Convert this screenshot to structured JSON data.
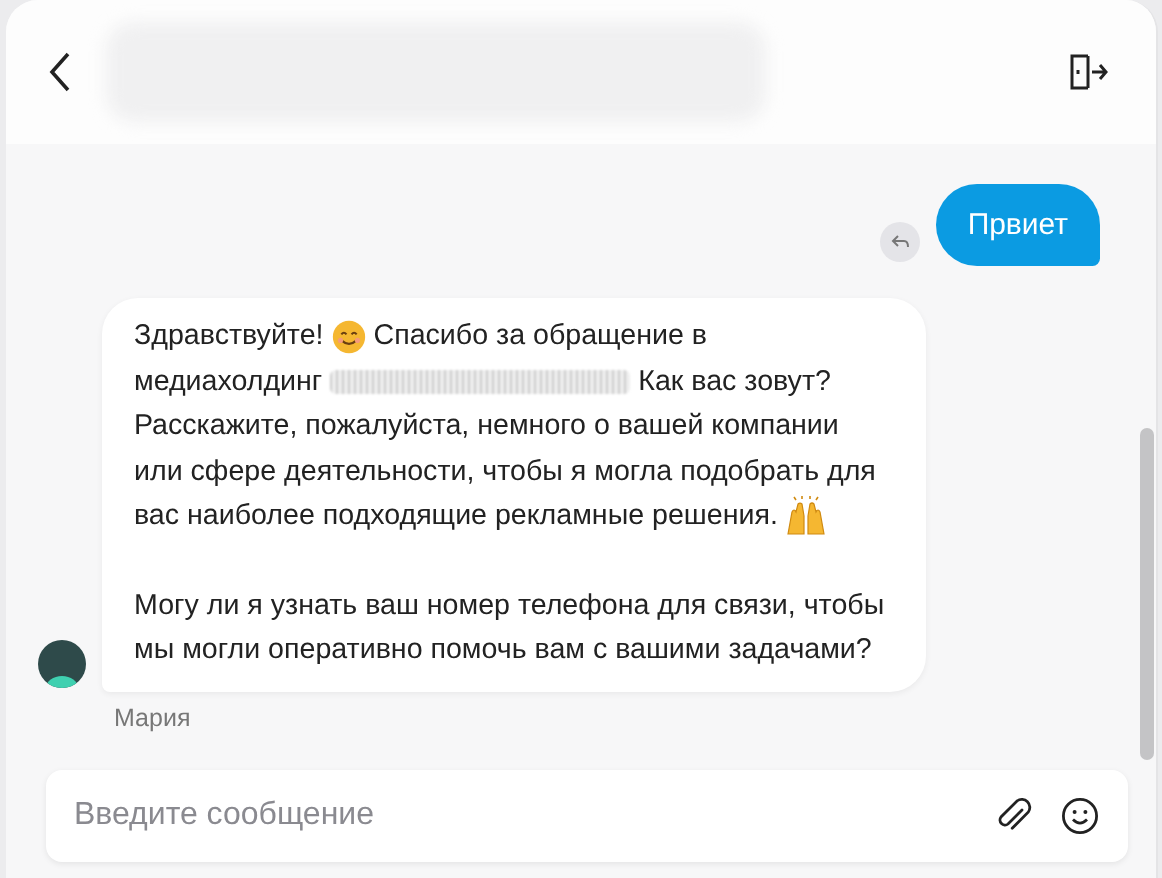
{
  "header": {
    "title_redacted": true
  },
  "messages": [
    {
      "kind": "outgoing",
      "text": "Првиет",
      "reply_icon": true
    },
    {
      "kind": "incoming",
      "author": "Мария",
      "paragraphs": [
        [
          [
            {
              "kind": "text",
              "text": "Здравствуйте!"
            },
            {
              "kind": "emoji-smile"
            },
            {
              "kind": "text",
              "text": "Спасибо за обращение в"
            }
          ],
          [
            {
              "kind": "text",
              "text": "медиахолдинг"
            },
            {
              "kind": "redacted"
            },
            {
              "kind": "text",
              "text": "Как вас зовут?"
            }
          ],
          [
            {
              "kind": "text",
              "text": "Расскажите, пожалуйста, немного о вашей компании"
            }
          ],
          [
            {
              "kind": "text",
              "text": "или сфере деятельности, чтобы я могла подобрать для"
            }
          ],
          [
            {
              "kind": "text",
              "text": "вас наиболее подходящие рекламные решения."
            },
            {
              "kind": "emoji-hands"
            }
          ]
        ],
        [
          [
            {
              "kind": "text",
              "text": "Могу ли я узнать ваш номер телефона для связи, чтобы"
            }
          ],
          [
            {
              "kind": "text",
              "text": "мы могли оперативно помочь вам с вашими задачами?"
            }
          ]
        ]
      ]
    }
  ],
  "composer": {
    "placeholder": "Введите сообщение"
  }
}
